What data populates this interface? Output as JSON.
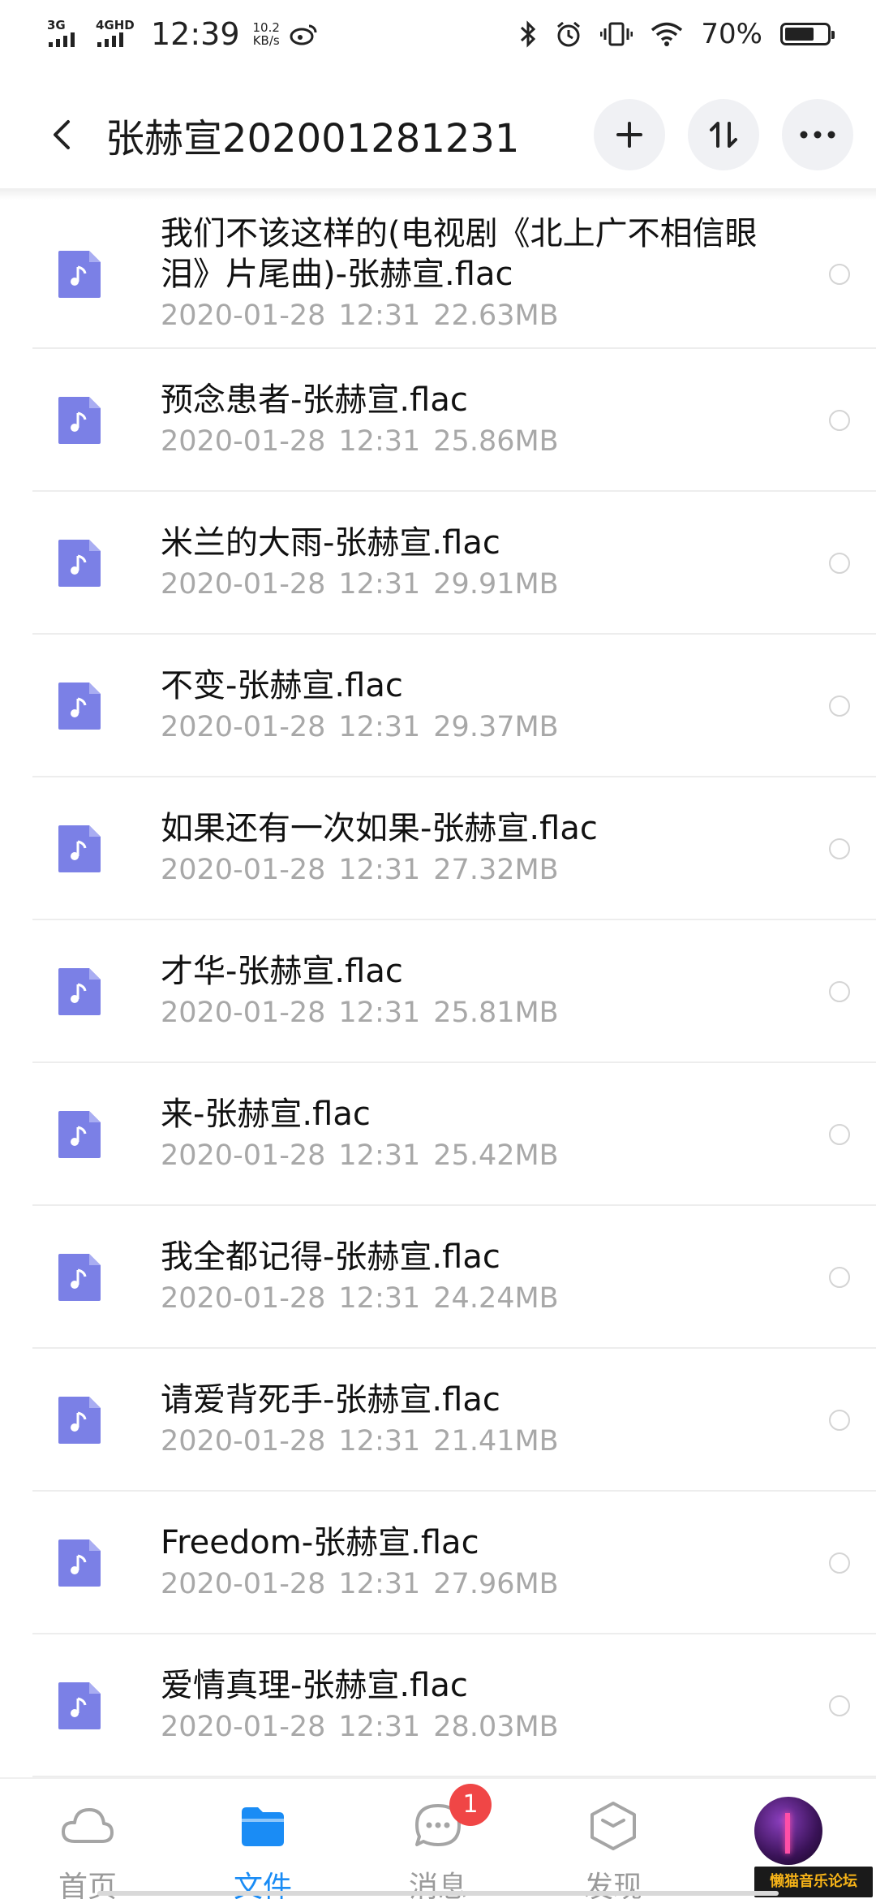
{
  "status_bar": {
    "network1": "3G",
    "network2": "4GHD",
    "time": "12:39",
    "speed_value": "10.2",
    "speed_unit": "KB/s",
    "battery_percent": "70%",
    "battery_level": 0.7,
    "icons": [
      "weibo-icon",
      "bluetooth-icon",
      "alarm-icon",
      "vibrate-icon",
      "wifi-icon",
      "battery-icon"
    ]
  },
  "header": {
    "title": "张赫宣202001281231",
    "buttons": [
      "back-icon",
      "add-icon",
      "sort-icon",
      "more-icon"
    ]
  },
  "files": [
    {
      "name": "我们不该这样的(电视剧《北上广不相信眼泪》片尾曲)-张赫宣.flac",
      "date": "2020-01-28",
      "time": "12:31",
      "size": "22.63MB"
    },
    {
      "name": "预念患者-张赫宣.flac",
      "date": "2020-01-28",
      "time": "12:31",
      "size": "25.86MB"
    },
    {
      "name": "米兰的大雨-张赫宣.flac",
      "date": "2020-01-28",
      "time": "12:31",
      "size": "29.91MB"
    },
    {
      "name": "不变-张赫宣.flac",
      "date": "2020-01-28",
      "time": "12:31",
      "size": "29.37MB"
    },
    {
      "name": "如果还有一次如果-张赫宣.flac",
      "date": "2020-01-28",
      "time": "12:31",
      "size": "27.32MB"
    },
    {
      "name": "才华-张赫宣.flac",
      "date": "2020-01-28",
      "time": "12:31",
      "size": "25.81MB"
    },
    {
      "name": "来-张赫宣.flac",
      "date": "2020-01-28",
      "time": "12:31",
      "size": "25.42MB"
    },
    {
      "name": "我全都记得-张赫宣.flac",
      "date": "2020-01-28",
      "time": "12:31",
      "size": "24.24MB"
    },
    {
      "name": "请爱背死手-张赫宣.flac",
      "date": "2020-01-28",
      "time": "12:31",
      "size": "21.41MB"
    },
    {
      "name": "Freedom-张赫宣.flac",
      "date": "2020-01-28",
      "time": "12:31",
      "size": "27.96MB"
    },
    {
      "name": "爱情真理-张赫宣.flac",
      "date": "2020-01-28",
      "time": "12:31",
      "size": "28.03MB"
    }
  ],
  "bottom_nav": {
    "items": [
      {
        "label": "首页",
        "icon": "cloud-icon"
      },
      {
        "label": "文件",
        "icon": "folder-icon"
      },
      {
        "label": "消息",
        "icon": "message-icon",
        "badge": "1"
      },
      {
        "label": "发现",
        "icon": "discover-icon"
      }
    ],
    "active": "文件"
  },
  "watermark": "懒猫音乐论坛",
  "colors": {
    "accent": "#1a8cf5",
    "file_icon": "#7b80e6",
    "meta_text": "#a8a8a8",
    "badge": "#f04646"
  }
}
